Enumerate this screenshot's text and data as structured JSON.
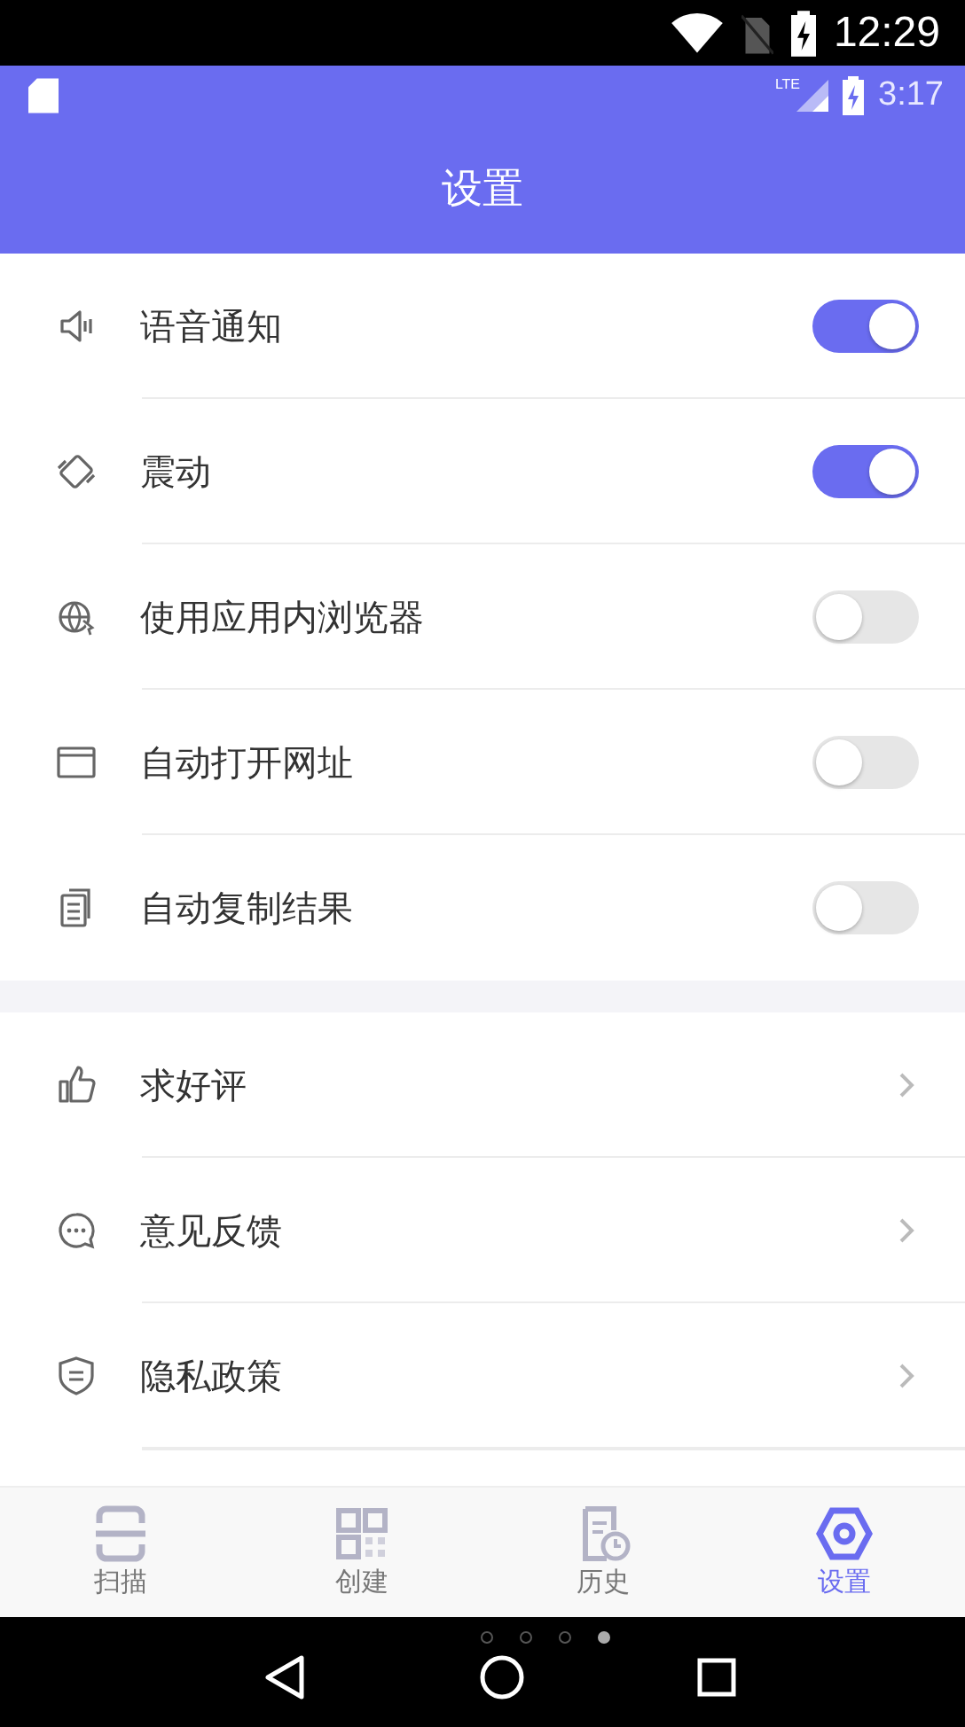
{
  "system_status_bar": {
    "time": "12:29"
  },
  "app_status_bar": {
    "network_type": "LTE",
    "time": "3:17"
  },
  "header": {
    "title": "设置"
  },
  "toggles": [
    {
      "label": "语音通知",
      "on": true
    },
    {
      "label": "震动",
      "on": true
    },
    {
      "label": "使用应用内浏览器",
      "on": false
    },
    {
      "label": "自动打开网址",
      "on": false
    },
    {
      "label": "自动复制结果",
      "on": false
    }
  ],
  "links": [
    {
      "label": "求好评"
    },
    {
      "label": "意见反馈"
    },
    {
      "label": "隐私政策"
    }
  ],
  "tabs": [
    {
      "label": "扫描",
      "selected": false
    },
    {
      "label": "创建",
      "selected": false
    },
    {
      "label": "历史",
      "selected": false
    },
    {
      "label": "设置",
      "selected": true
    }
  ],
  "page_dots": [
    {
      "selected": false
    },
    {
      "selected": false
    },
    {
      "selected": false
    },
    {
      "selected": true
    }
  ]
}
